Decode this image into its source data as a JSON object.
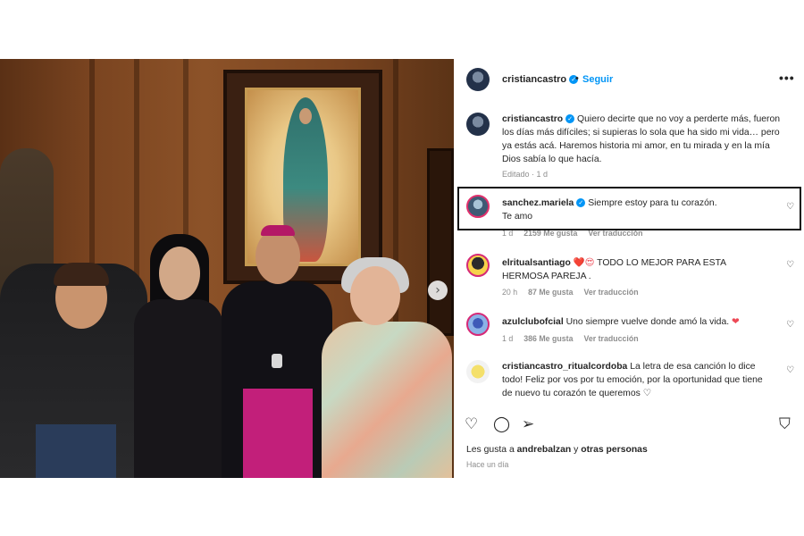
{
  "post": {
    "author": "cristiancastro",
    "follow_label": "Seguir",
    "more_label": "•••",
    "caption": {
      "user": "cristiancastro",
      "text": "Quiero decirte que no voy a perderte más, fueron los días más difíciles; si supieras lo sola que ha sido mi vida… pero ya estás acá. Haremos historia mi amor, en tu mirada y en la mía Dios sabía lo que hacía.",
      "meta": "Editado · 1 d"
    },
    "comments": [
      {
        "user": "sanchez.mariela",
        "verified": true,
        "text": "Siempre estoy para tu corazón.",
        "text2": "Te amo",
        "time": "1 d",
        "likes": "2159 Me gusta",
        "translate": "Ver traducción"
      },
      {
        "user": "elritualsantiago",
        "text": "TODO LO MEJOR PARA ESTA HERMOSA PAREJA .",
        "emoji": "❤️😍",
        "time": "20 h",
        "likes": "87 Me gusta",
        "translate": "Ver traducción"
      },
      {
        "user": "azulclubofcial",
        "text": "Uno siempre vuelve donde amó la vida.",
        "time": "1 d",
        "likes": "386 Me gusta",
        "translate": "Ver traducción"
      },
      {
        "user": "cristiancastro_ritualcordoba",
        "text": "La letra de esa canción lo dice todo! Feliz por vos por tu emoción, por la oportunidad que tiene de nuevo tu corazón te queremos ♡"
      }
    ],
    "liked_by_prefix": "Les gusta a",
    "liked_by_user": "andrebalzan",
    "liked_by_connector": "y",
    "liked_by_others": "otras personas",
    "posted_ago": "Hace un día"
  },
  "icons": {
    "like": "heart-outline-icon",
    "comment": "comment-bubble-icon",
    "share": "paper-plane-icon",
    "save": "bookmark-icon",
    "next": "chevron-right-icon"
  },
  "colors": {
    "accent": "#0095f6",
    "highlight_border": "#111111",
    "muted": "#8e8e8e"
  }
}
